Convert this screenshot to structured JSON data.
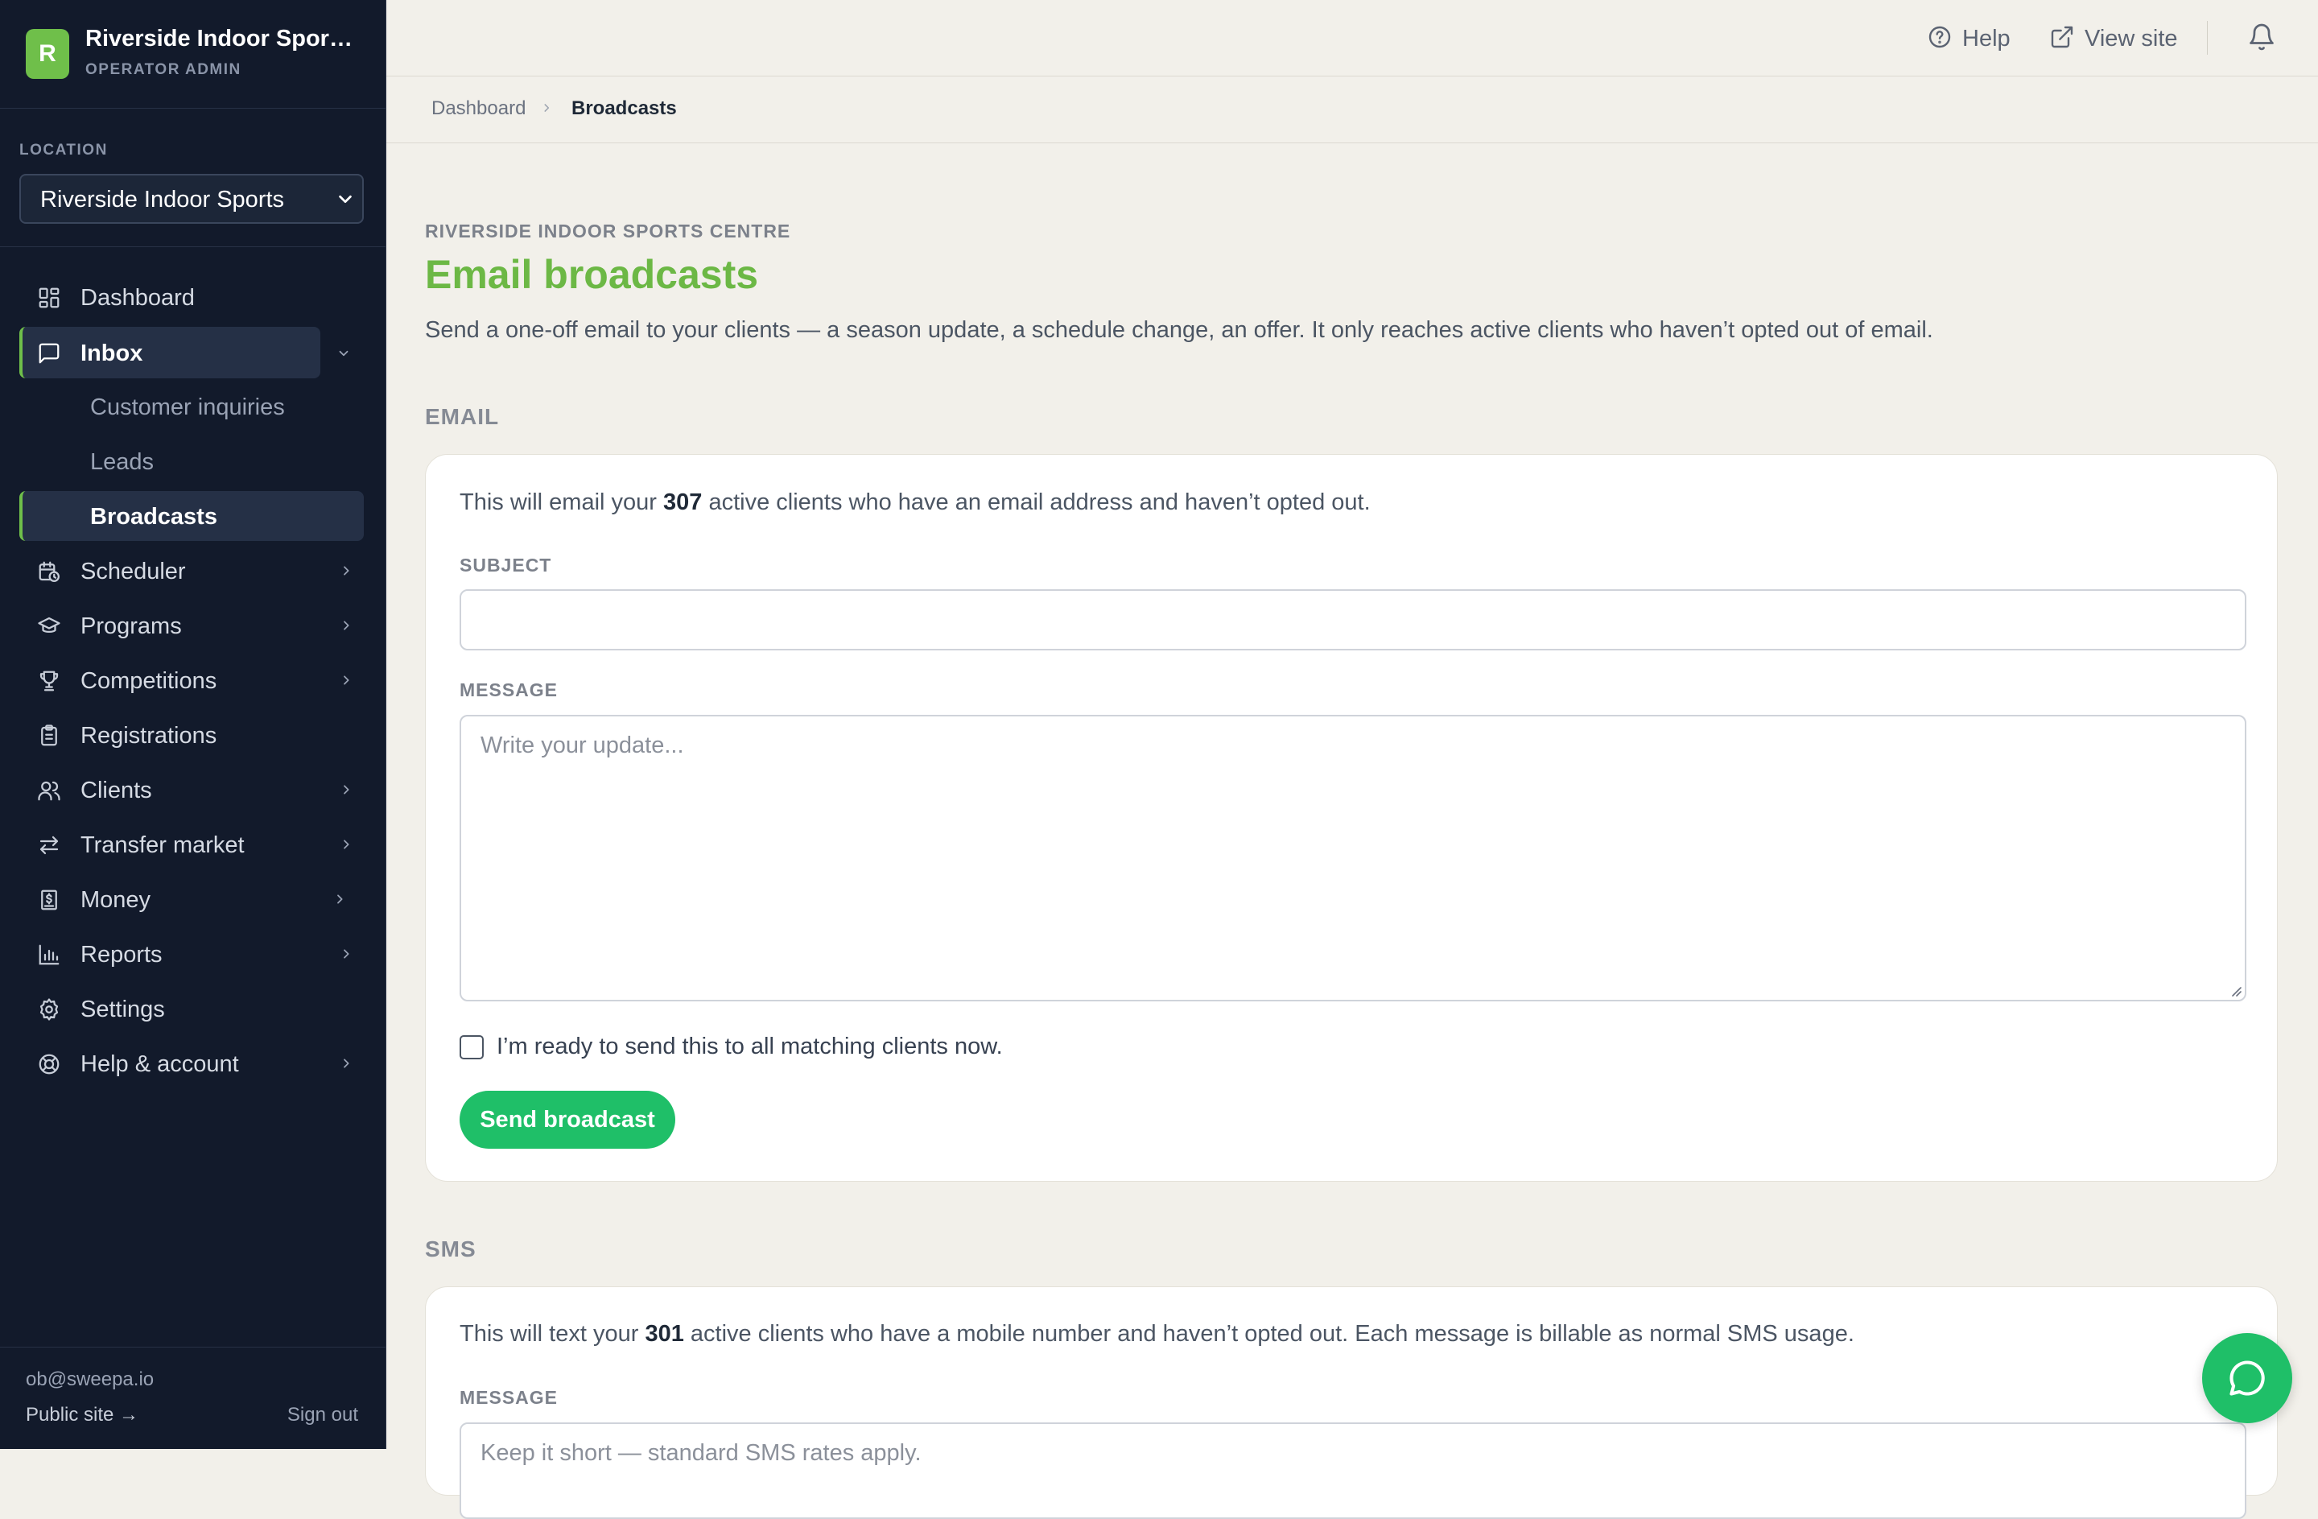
{
  "app": {
    "name": "Riverside Indoor Sports ...",
    "role": "OPERATOR ADMIN",
    "logo_letter": "R",
    "accent": "#6fbf4a",
    "primary_button": "#1fbf68"
  },
  "location": {
    "label": "LOCATION",
    "selected": "Riverside Indoor Sports"
  },
  "nav": {
    "dashboard": "Dashboard",
    "inbox": "Inbox",
    "inbox_children": {
      "customer_inquiries": "Customer inquiries",
      "leads": "Leads",
      "broadcasts": "Broadcasts"
    },
    "scheduler": "Scheduler",
    "programs": "Programs",
    "competitions": "Competitions",
    "registrations": "Registrations",
    "clients": "Clients",
    "transfer_market": "Transfer market",
    "money": "Money",
    "reports": "Reports",
    "settings": "Settings",
    "help_account": "Help & account"
  },
  "footer": {
    "email": "ob@sweepa.io",
    "public_site": "Public site →",
    "sign_out": "Sign out"
  },
  "topbar": {
    "help": "Help",
    "view_site": "View site"
  },
  "breadcrumb": {
    "parent": "Dashboard",
    "current": "Broadcasts"
  },
  "page": {
    "eyebrow": "RIVERSIDE INDOOR SPORTS CENTRE",
    "title": "Email broadcasts",
    "description": "Send a one-off email to your clients — a season update, a schedule change, an offer. It only reaches active clients who haven’t opted out of email."
  },
  "email_section": {
    "label": "EMAIL",
    "intro_before": "This will email your ",
    "count": "307",
    "intro_after": " active clients who have an email address and haven’t opted out.",
    "subject_label": "SUBJECT",
    "subject_value": "",
    "message_label": "MESSAGE",
    "message_placeholder": "Write your update...",
    "confirm_label": "I’m ready to send this to all matching clients now.",
    "confirm_checked": false,
    "send_label": "Send broadcast"
  },
  "sms_section": {
    "label": "SMS",
    "intro_before": "This will text your ",
    "count": "301",
    "intro_after": " active clients who have a mobile number and haven’t opted out. Each message is billable as normal SMS usage.",
    "message_label": "MESSAGE",
    "message_placeholder": "Keep it short — standard SMS rates apply."
  }
}
